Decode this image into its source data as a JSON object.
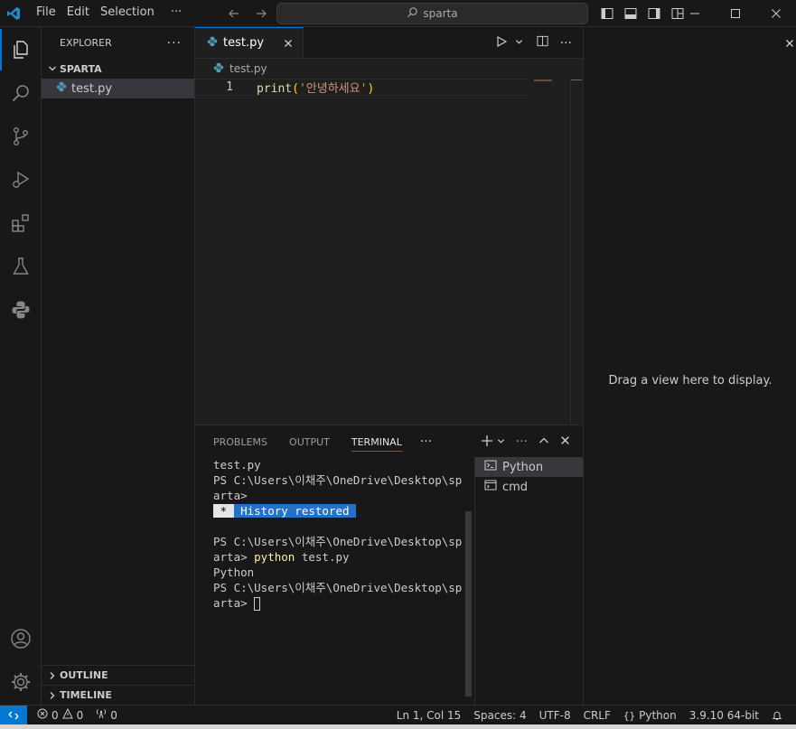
{
  "titlebar": {
    "menu": [
      "File",
      "Edit",
      "Selection",
      "···"
    ],
    "search_text": "sparta"
  },
  "sidebar": {
    "header": "EXPLORER",
    "folder": "SPARTA",
    "files": [
      "test.py"
    ],
    "outline": "OUTLINE",
    "timeline": "TIMELINE"
  },
  "editor": {
    "tab_label": "test.py",
    "breadcrumb": "test.py",
    "lines": [
      {
        "no": "1",
        "fn": "print",
        "open": "(",
        "str": "'안녕하세요'",
        "close": ")"
      }
    ]
  },
  "panel": {
    "tabs": [
      "PROBLEMS",
      "OUTPUT",
      "TERMINAL"
    ],
    "active_tab": "TERMINAL",
    "terminal": {
      "l1": "test.py",
      "l2": "PS C:\\Users\\이채주\\OneDrive\\Desktop\\sp",
      "l3": "arta>",
      "history_star": " * ",
      "history_text": " History restored ",
      "l5": "PS C:\\Users\\이채주\\OneDrive\\Desktop\\sp",
      "l6_prompt": "arta> ",
      "l6_cmd": "python",
      "l6_arg": " test.py",
      "l7": "Python",
      "l8": "PS C:\\Users\\이채주\\OneDrive\\Desktop\\sp",
      "l9": "arta> "
    },
    "terminals": [
      "Python",
      "cmd"
    ]
  },
  "aux": {
    "message": "Drag a view here to display."
  },
  "statusbar": {
    "errors": "0",
    "warnings": "0",
    "ports": "0",
    "position": "Ln 1, Col 15",
    "spaces": "Spaces: 4",
    "encoding": "UTF-8",
    "eol": "CRLF",
    "language": "Python",
    "interpreter": "3.9.10 64-bit"
  },
  "colors": {
    "accent": "#0078d4",
    "background": "#1f1f1f",
    "chrome": "#181818"
  }
}
